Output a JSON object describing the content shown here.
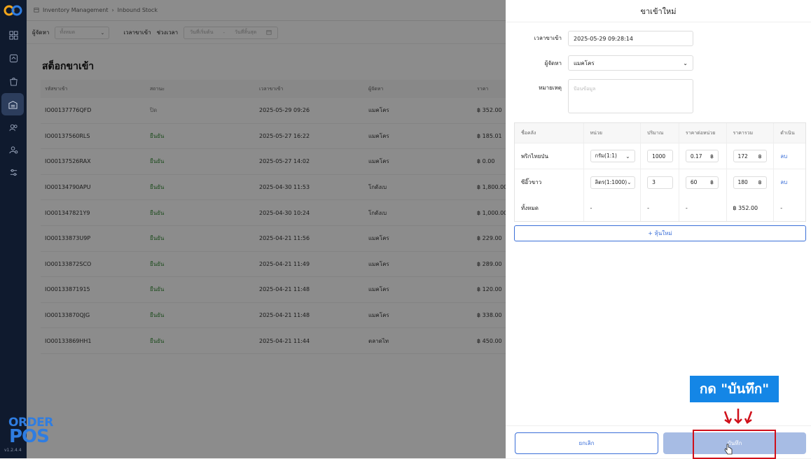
{
  "breadcrumb": {
    "parent": "Inventory Management",
    "current": "Inbound Stock"
  },
  "filters": {
    "supplier_label": "ผู้จัดหา",
    "supplier_value": "ทั้งหมด",
    "time_label": "เวลาขาเข้า",
    "range_label": "ช่วงเวลา",
    "start_placeholder": "วันที่เริ่มต้น",
    "separator": "-",
    "end_placeholder": "วันที่สิ้นสุด"
  },
  "page_title": "สต็อกขาเข้า",
  "table": {
    "headers": [
      "รหัสขาเข้า",
      "สถานะ",
      "เวลาขาเข้า",
      "ผู้จัดหา",
      "ราคา"
    ],
    "rows": [
      {
        "id": "IO00137776QFD",
        "status": "ปิด",
        "time": "2025-05-29 09:26",
        "supplier": "แมคโคร",
        "price": "฿ 352.00"
      },
      {
        "id": "IO00137560RLS",
        "status": "ยืนยัน",
        "time": "2025-05-27 16:22",
        "supplier": "แมคโคร",
        "price": "฿ 185.01"
      },
      {
        "id": "IO00137526RAX",
        "status": "ยืนยัน",
        "time": "2025-05-27 14:02",
        "supplier": "แมคโคร",
        "price": "฿ 0.00"
      },
      {
        "id": "IO00134790APU",
        "status": "ยืนยัน",
        "time": "2025-04-30 11:53",
        "supplier": "โกดังเบ",
        "price": "฿ 1,800.00"
      },
      {
        "id": "IO001347821Y9",
        "status": "ยืนยัน",
        "time": "2025-04-30 10:24",
        "supplier": "โกดังเบ",
        "price": "฿ 1,000.00"
      },
      {
        "id": "IO00133873U9P",
        "status": "ยืนยัน",
        "time": "2025-04-21 11:56",
        "supplier": "แมคโคร",
        "price": "฿ 229.00"
      },
      {
        "id": "IO00133872SCO",
        "status": "ยืนยัน",
        "time": "2025-04-21 11:49",
        "supplier": "แมคโคร",
        "price": "฿ 289.00"
      },
      {
        "id": "IO00133871915",
        "status": "ยืนยัน",
        "time": "2025-04-21 11:48",
        "supplier": "แมคโคร",
        "price": "฿ 120.00"
      },
      {
        "id": "IO00133870QJG",
        "status": "ยืนยัน",
        "time": "2025-04-21 11:48",
        "supplier": "แมคโคร",
        "price": "฿ 338.00"
      },
      {
        "id": "IO00133869HH1",
        "status": "ยืนยัน",
        "time": "2025-04-21 11:44",
        "supplier": "ตลาดไท",
        "price": "฿ 450.00"
      }
    ]
  },
  "drawer": {
    "title": "ขาเข้าใหม่",
    "time_label": "เวลาขาเข้า",
    "time_value": "2025-05-29 09:28:14",
    "supplier_label": "ผู้จัดหา",
    "supplier_value": "แมคโคร",
    "note_label": "หมายเหตุ",
    "note_placeholder": "ป้อนข้อมูล",
    "item_headers": [
      "ชื่อคลัง",
      "หน่วย",
      "ปริมาณ",
      "ราคาต่อหน่วย",
      "ราคารวม",
      "ดำเนิน"
    ],
    "items": [
      {
        "name": "พริกไทยป่น",
        "unit": "กรัม(1:1)",
        "qty": "1000",
        "unit_price": "0.17",
        "total": "172",
        "action": "ลบ"
      },
      {
        "name": "ซีอิ๊วขาว",
        "unit": "ลิตร(1:1000)",
        "qty": "3",
        "unit_price": "60",
        "total": "180",
        "action": "ลบ"
      }
    ],
    "summary": {
      "label": "ทั้งหมด",
      "unit": "-",
      "qty": "-",
      "unit_price": "-",
      "total": "฿ 352.00",
      "action": "-"
    },
    "currency": "฿",
    "add_label": "+ หุ้นใหม่",
    "cancel_label": "ยกเลิก",
    "save_label": "บันทึก",
    "callout_text": "กด \"บันทึก\""
  },
  "brand": {
    "line1": "ORDER",
    "line2": "POS"
  },
  "version": "v1.2.4.4",
  "colors": {
    "sidebar": "#0f1a2e",
    "accent": "#3b6fd8",
    "callout": "#1486e6",
    "highlight": "#d0101a"
  }
}
